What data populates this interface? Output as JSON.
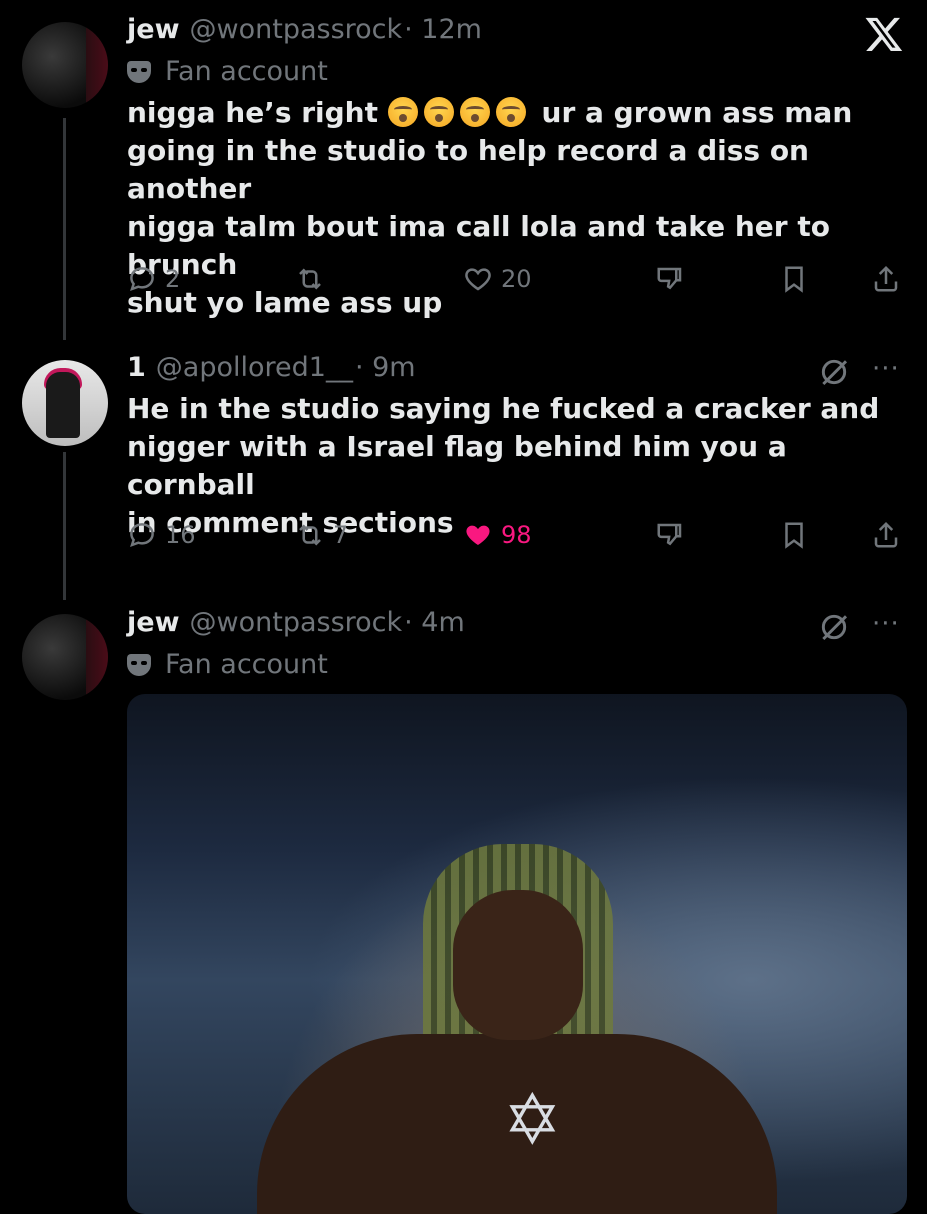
{
  "app": {
    "logo_icon": "x-logo-icon"
  },
  "colors": {
    "background": "#000000",
    "text": "#e7e9ea",
    "muted": "#71767b",
    "like": "#f91880",
    "thread_line": "#333639"
  },
  "tweets": [
    {
      "name": "jew",
      "handle": "@wontpassrock",
      "time": "· 12m",
      "label": "Fan account",
      "text_lines": [
        "nigga he’s right",
        "ur a grown ass man",
        "going in the studio to help record a diss on another",
        "nigga talm bout ima call lola and take her to brunch",
        "shut yo lame ass up"
      ],
      "emoji_count": 4,
      "emoji_icon": "loudly-crying-face-emoji",
      "replies": "2",
      "reposts": "",
      "likes": "20",
      "liked": false
    },
    {
      "name": "1",
      "handle": "@apollored1__",
      "time": "· 9m",
      "text_lines": [
        "He in the studio saying he fucked a cracker and",
        "nigger with a Israel flag behind him you a cornball",
        "in comment sections"
      ],
      "replies": "16",
      "reposts": "7",
      "likes": "98",
      "liked": true,
      "more": "···"
    },
    {
      "name": "jew",
      "handle": "@wontpassrock",
      "time": "· 4m",
      "label": "Fan account",
      "more": "···",
      "media": "photo-of-man-with-locs-and-star-of-david-chain"
    }
  ]
}
